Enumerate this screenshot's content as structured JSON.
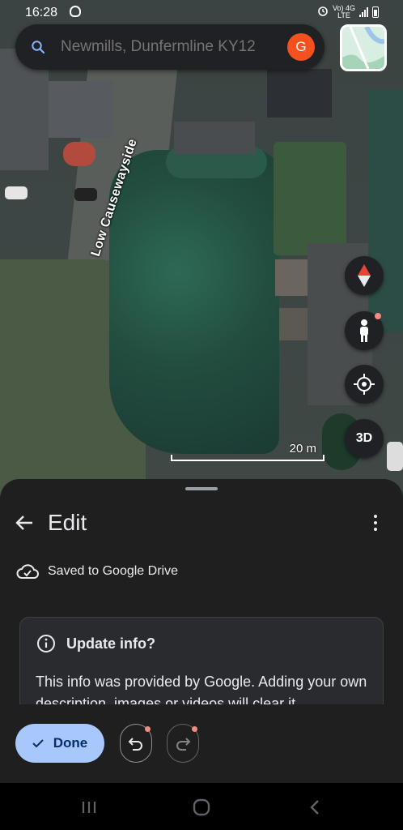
{
  "status_bar": {
    "time": "16:28",
    "signal_label_top": "Vo) 4G",
    "signal_label_bottom": "LTE"
  },
  "search": {
    "placeholder": "Newmills, Dunfermline KY12",
    "avatar_letter": "G"
  },
  "map": {
    "road_label": "Low Causewayside",
    "scale_label": "20 m",
    "three_d_label": "3D"
  },
  "sheet": {
    "title": "Edit",
    "saved_text": "Saved to Google Drive",
    "card_title": "Update info?",
    "card_body": "This info was provided by Google. Adding your own description, images or videos will clear it"
  },
  "actions": {
    "done_label": "Done"
  },
  "colors": {
    "accent": "#a8c7fa",
    "avatar": "#f4511e",
    "notification_dot": "#f28b82"
  }
}
